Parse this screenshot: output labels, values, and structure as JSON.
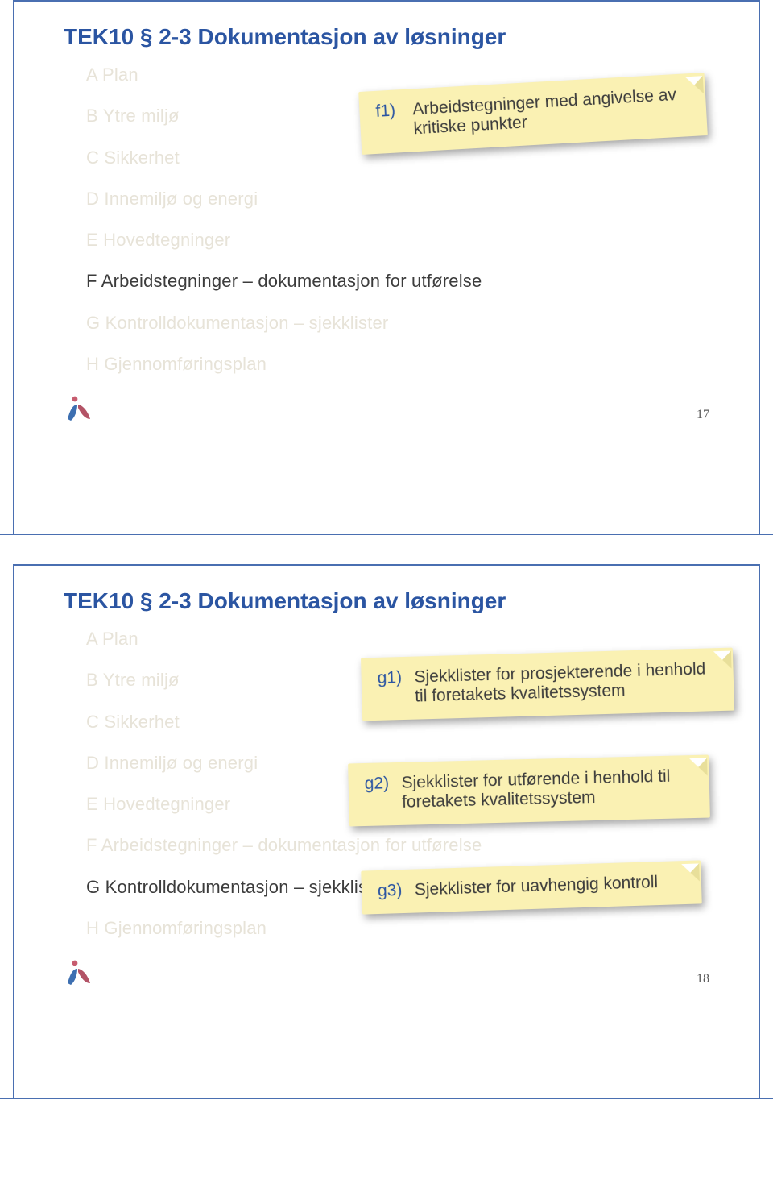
{
  "slides": [
    {
      "title": "TEK10 § 2-3 Dokumentasjon av løsninger",
      "items": [
        {
          "text": "A Plan",
          "muted": true
        },
        {
          "text": "B Ytre miljø",
          "muted": true
        },
        {
          "text": "C Sikkerhet",
          "muted": true
        },
        {
          "text": "D Innemiljø og energi",
          "muted": true
        },
        {
          "text": "E Hovedtegninger",
          "muted": true
        },
        {
          "text": "F Arbeidstegninger – dokumentasjon for utførelse",
          "muted": false
        },
        {
          "text": "G Kontrolldokumentasjon – sjekklister",
          "muted": true
        },
        {
          "text": "H Gjennomføringsplan",
          "muted": true
        }
      ],
      "callouts": [
        {
          "num": "f1)",
          "text": "Arbeidstegninger med angivelse av kritiske punkter"
        }
      ],
      "page_number": "17"
    },
    {
      "title": "TEK10 § 2-3 Dokumentasjon av løsninger",
      "items": [
        {
          "text": "A Plan",
          "muted": true
        },
        {
          "text": "B Ytre miljø",
          "muted": true
        },
        {
          "text": "C Sikkerhet",
          "muted": true
        },
        {
          "text": "D Innemiljø og energi",
          "muted": true
        },
        {
          "text": "E Hovedtegninger",
          "muted": true
        },
        {
          "text": "F Arbeidstegninger – dokumentasjon for utførelse",
          "muted": true
        },
        {
          "text": "G Kontrolldokumentasjon – sjekklister",
          "muted": false
        },
        {
          "text": "H Gjennomføringsplan",
          "muted": true
        }
      ],
      "callouts": [
        {
          "num": "g1)",
          "text": "Sjekklister for prosjekterende i henhold til foretakets kvalitetssystem"
        },
        {
          "num": "g2)",
          "text": "Sjekklister for utførende i henhold til foretakets kvalitetssystem"
        },
        {
          "num": "g3)",
          "text": "Sjekklister for uavhengig kontroll"
        }
      ],
      "page_number": "18"
    }
  ]
}
